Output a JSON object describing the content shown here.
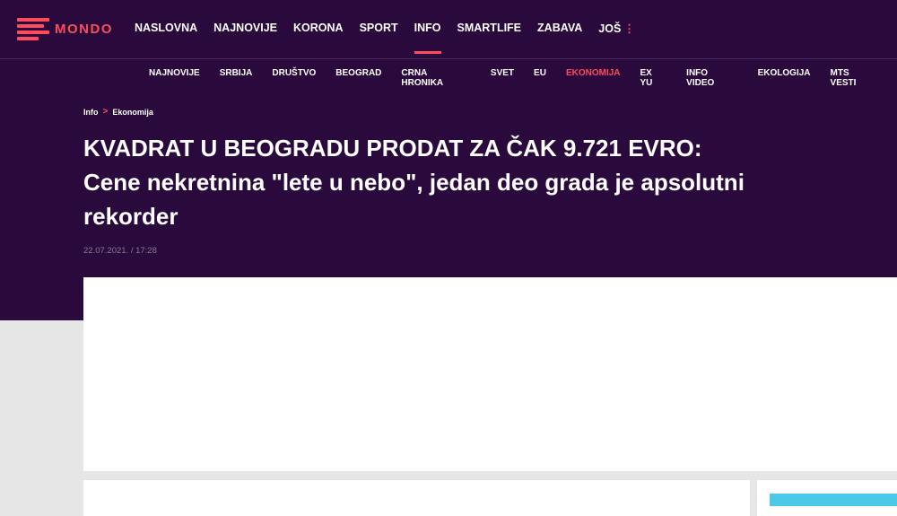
{
  "brand": {
    "name": "MONDO",
    "accent": "#ff4b5c",
    "background": "#2a0a3c"
  },
  "main_nav": {
    "items": [
      {
        "label": "NASLOVNA"
      },
      {
        "label": "NAJNOVIJE"
      },
      {
        "label": "KORONA"
      },
      {
        "label": "SPORT"
      },
      {
        "label": "INFO",
        "active": true
      },
      {
        "label": "SMARTLIFE"
      },
      {
        "label": "ZABAVA"
      },
      {
        "label": "JOŠ"
      }
    ],
    "more_icon": "⋮"
  },
  "sub_nav": {
    "items": [
      {
        "label": "NAJNOVIJE"
      },
      {
        "label": "SRBIJA"
      },
      {
        "label": "DRUŠTVO"
      },
      {
        "label": "BEOGRAD"
      },
      {
        "label": "CRNA HRONIKA"
      },
      {
        "label": "SVET"
      },
      {
        "label": "EU"
      },
      {
        "label": "EKONOMIJA",
        "active": true
      },
      {
        "label": "EX YU"
      },
      {
        "label": "INFO VIDEO"
      },
      {
        "label": "EKOLOGIJA"
      },
      {
        "label": "MTS VESTI"
      }
    ]
  },
  "breadcrumb": {
    "first": "Info",
    "separator": ">",
    "second": "Ekonomija"
  },
  "article": {
    "title": "KVADRAT U BEOGRADU PRODAT ZA ČAK 9.721 EVRO: Cene nekretnina \"lete u nebo\", jedan deo grada je apsolutni rekorder",
    "date": "22.07.2021. / 17:28"
  }
}
